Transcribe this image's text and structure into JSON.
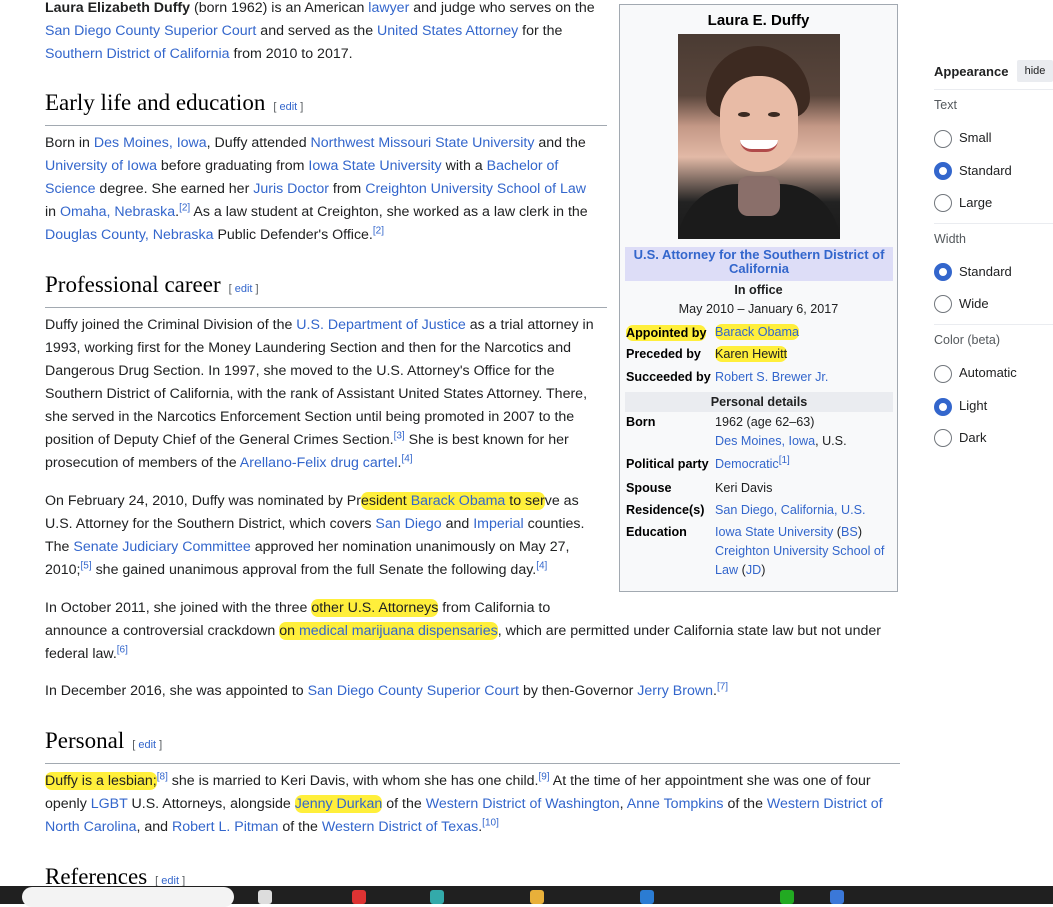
{
  "intro": {
    "name_bold": "Laura Elizabeth Duffy",
    "t1": " (born 1962) is an American ",
    "link_lawyer": "lawyer",
    "t2": " and judge who serves on the",
    "link_court": "San Diego County Superior Court",
    "t3": " and served as the ",
    "link_usa": "United States Attorney",
    "t4": " for the",
    "link_district": "Southern District of California",
    "t5": " from 2010 to 2017."
  },
  "sections": {
    "early": {
      "title": "Early life and education",
      "edit": "edit"
    },
    "career": {
      "title": "Professional career",
      "edit": "edit"
    },
    "personal": {
      "title": "Personal",
      "edit": "edit"
    },
    "references": {
      "title": "References",
      "edit": "edit"
    }
  },
  "early": {
    "a1": "Born in ",
    "l_desmoines": "Des Moines, Iowa",
    "a2": ", Duffy attended ",
    "l_nwmsu": "Northwest Missouri State University",
    "a3": " and the",
    "l_uiowa": "University of Iowa",
    "a4": " before graduating from ",
    "l_isu": "Iowa State University",
    "a5": " with a ",
    "l_bs1": "Bachelor of",
    "l_bs2": "Science",
    "a6": " degree. She earned her ",
    "l_jd": "Juris Doctor",
    "a7": " from ",
    "l_creighton": "Creighton University School of Law",
    "a8": "in ",
    "l_omaha": "Omaha, Nebraska",
    "a9": ".",
    "ref2": "[2]",
    "a10": " As a law student at Creighton, she worked as a law clerk in the",
    "l_douglas": "Douglas County, Nebraska",
    "a11": " Public Defender's Office.",
    "ref2b": "[2]"
  },
  "career": {
    "p1_a": "Duffy joined the Criminal Division of the ",
    "p1_l_doj": "U.S. Department of Justice",
    "p1_b": " as a trial attorney in",
    "p1_line2": "1993, working first for the Money Laundering Section and then for the Narcotics and",
    "p1_line3": "Dangerous Drug Section. In 1997, she moved to the U.S. Attorney's Office for the",
    "p1_line4": "Southern District of California, with the rank of Assistant United States Attorney. There,",
    "p1_line5": "she served in the Narcotics Enforcement Section until being promoted in 2007 to the",
    "p1_line6": "position of Deputy Chief of the General Crimes Section.",
    "ref3": "[3]",
    "p1_c": " She is best known for her",
    "p1_d": "prosecution of members of the ",
    "p1_l_af": "Arellano-Felix drug cartel",
    "p1_e": ".",
    "ref4": "[4]",
    "p2_a": "On February 24, 2010, Duffy was nominated by Pr",
    "p2_hl1": "esident ",
    "p2_l_obama": "Barack Obama",
    "p2_hl2": " to ser",
    "p2_b": "ve as",
    "p2_c": "U.S. Attorney for the Southern District, which covers ",
    "p2_l_sd": "San Diego",
    "p2_d": " and ",
    "p2_l_imp": "Imperial",
    "p2_e": " counties.",
    "p2_f": "The ",
    "p2_l_sjc": "Senate Judiciary Committee",
    "p2_g": " approved her nomination unanimously on May 27,",
    "p2_h": "2010;",
    "ref5": "[5]",
    "p2_i": " she gained unanimous approval from the full Senate the following day.",
    "ref4b": "[4]",
    "p3_a": "In October 2011, she joined with the three ",
    "p3_hl": "other U.S. Attorneys",
    "p3_b": " from California to",
    "p3_c": "announce a controversial crackdown ",
    "p3_hl2": "on ",
    "p3_l_mmd": "medical marijuana dispensaries",
    "p3_d": ", which are permitted under California state law but not under",
    "p3_e": "federal law.",
    "ref6": "[6]",
    "p4_a": "In December 2016, she was appointed to ",
    "p4_l_court": "San Diego County Superior Court",
    "p4_b": " by then-Governor ",
    "p4_l_brown": "Jerry Brown",
    "p4_c": ".",
    "ref7": "[7]"
  },
  "personal": {
    "a": "Duffy is a lesbian;",
    "ref8": "[8]",
    "b": " she is married to Keri Davis, with whom she has one child.",
    "ref9": "[9]",
    "c": " At the time of her appointment she was one of four",
    "d": "openly ",
    "l_lgbt": "LGBT",
    "e": " U.S. Attorneys, alongside ",
    "l_durkan": "Jenny Durkan",
    "f": " of the ",
    "l_wdw": "Western District of Washington",
    "g": ", ",
    "l_tompkins": "Anne Tompkins",
    "h": " of the ",
    "l_wd": "Western District of",
    "l_nc": "North Carolina",
    "i": ", and ",
    "l_pitman": "Robert L. Pitman",
    "j": " of the ",
    "l_wdt": "Western District of Texas",
    "k": ".",
    "ref10": "[10]"
  },
  "infobox": {
    "name": "Laura E. Duffy",
    "office": "U.S. Attorney for the Southern District of California",
    "in_office": "In office",
    "term": "May 2010 – January 6, 2017",
    "appointed_label": "Appointed by",
    "appointed_value": "Barack Obama",
    "preceded_label": "Preceded by",
    "preceded_value": "Karen Hewitt",
    "succeeded_label": "Succeeded by",
    "succeeded_value": "Robert S. Brewer Jr.",
    "personal_details": "Personal details",
    "born_label": "Born",
    "born_value": "1962 (age 62–63)",
    "born_place": "Des Moines, Iowa",
    "born_country": ", U.S.",
    "party_label": "Political party",
    "party_value": "Democratic",
    "party_ref": "[1]",
    "spouse_label": "Spouse",
    "spouse_value": "Keri Davis",
    "residence_label": "Residence(s)",
    "residence_value": "San Diego, California, U.S.",
    "education_label": "Education",
    "edu1": "Iowa State University",
    "edu1_deg": "BS",
    "edu2": "Creighton University School of",
    "edu2b": "Law",
    "edu2_deg": "JD"
  },
  "appearance": {
    "title": "Appearance",
    "hide": "hide",
    "text_label": "Text",
    "text_options": [
      "Small",
      "Standard",
      "Large"
    ],
    "text_selected": "Standard",
    "width_label": "Width",
    "width_options": [
      "Standard",
      "Wide"
    ],
    "width_selected": "Standard",
    "color_label": "Color (beta)",
    "color_options": [
      "Automatic",
      "Light",
      "Dark"
    ],
    "color_selected": "Light"
  },
  "colors": {
    "link": "#3366cc",
    "highlight": "#ffef3b",
    "radio_selected": "#3366cc"
  }
}
